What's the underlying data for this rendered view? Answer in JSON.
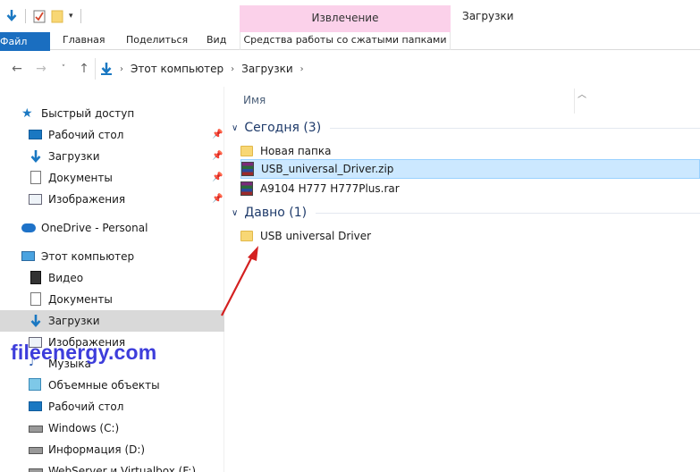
{
  "window": {
    "title": "Загрузки",
    "contextual_tab_group": "Извлечение"
  },
  "ribbon": {
    "tabs": [
      {
        "label": "Файл"
      },
      {
        "label": "Главная"
      },
      {
        "label": "Поделиться"
      },
      {
        "label": "Вид"
      },
      {
        "label": "Средства работы со сжатыми папками"
      }
    ]
  },
  "address": {
    "crumbs": [
      "Этот компьютер",
      "Загрузки"
    ]
  },
  "nav": {
    "items": [
      {
        "label": "Быстрый доступ",
        "icon": "star-icon"
      },
      {
        "label": "Рабочий стол",
        "icon": "desktop-icon",
        "pinned": true
      },
      {
        "label": "Загрузки",
        "icon": "download-icon",
        "pinned": true
      },
      {
        "label": "Документы",
        "icon": "document-icon",
        "pinned": true
      },
      {
        "label": "Изображения",
        "icon": "image-icon",
        "pinned": true
      },
      {
        "label": "OneDrive - Personal",
        "icon": "cloud-icon"
      },
      {
        "label": "Этот компьютер",
        "icon": "computer-icon"
      },
      {
        "label": "Видео",
        "icon": "video-icon"
      },
      {
        "label": "Документы",
        "icon": "document-icon"
      },
      {
        "label": "Загрузки",
        "icon": "download-icon",
        "selected": true
      },
      {
        "label": "Изображения",
        "icon": "image-icon"
      },
      {
        "label": "Музыка",
        "icon": "music-icon"
      },
      {
        "label": "Объемные объекты",
        "icon": "3d-objects-icon"
      },
      {
        "label": "Рабочий стол",
        "icon": "desktop-icon"
      },
      {
        "label": "Windows (C:)",
        "icon": "drive-icon"
      },
      {
        "label": "Информация (D:)",
        "icon": "drive-icon"
      },
      {
        "label": "WebServer и Virtualbox (F:)",
        "icon": "drive-icon"
      }
    ]
  },
  "main": {
    "column_header": "Имя",
    "groups": [
      {
        "label": "Сегодня (3)",
        "files": [
          {
            "name": "Новая папка",
            "type": "folder"
          },
          {
            "name": "USB_universal_Driver.zip",
            "type": "archive",
            "selected": true
          },
          {
            "name": "A9104 H777 H777Plus.rar",
            "type": "archive"
          }
        ]
      },
      {
        "label": "Давно (1)",
        "files": [
          {
            "name": "USB universal Driver",
            "type": "folder"
          }
        ]
      }
    ]
  },
  "watermark": "fileenergy.com",
  "colors": {
    "file_tab": "#1a6ec0",
    "context_tab": "#fbd1ea",
    "selection": "#cce8ff",
    "nav_selected": "#d9d9d9",
    "group_header": "#1e3a6a",
    "watermark": "#3d3ddb",
    "arrow": "#d42020"
  }
}
